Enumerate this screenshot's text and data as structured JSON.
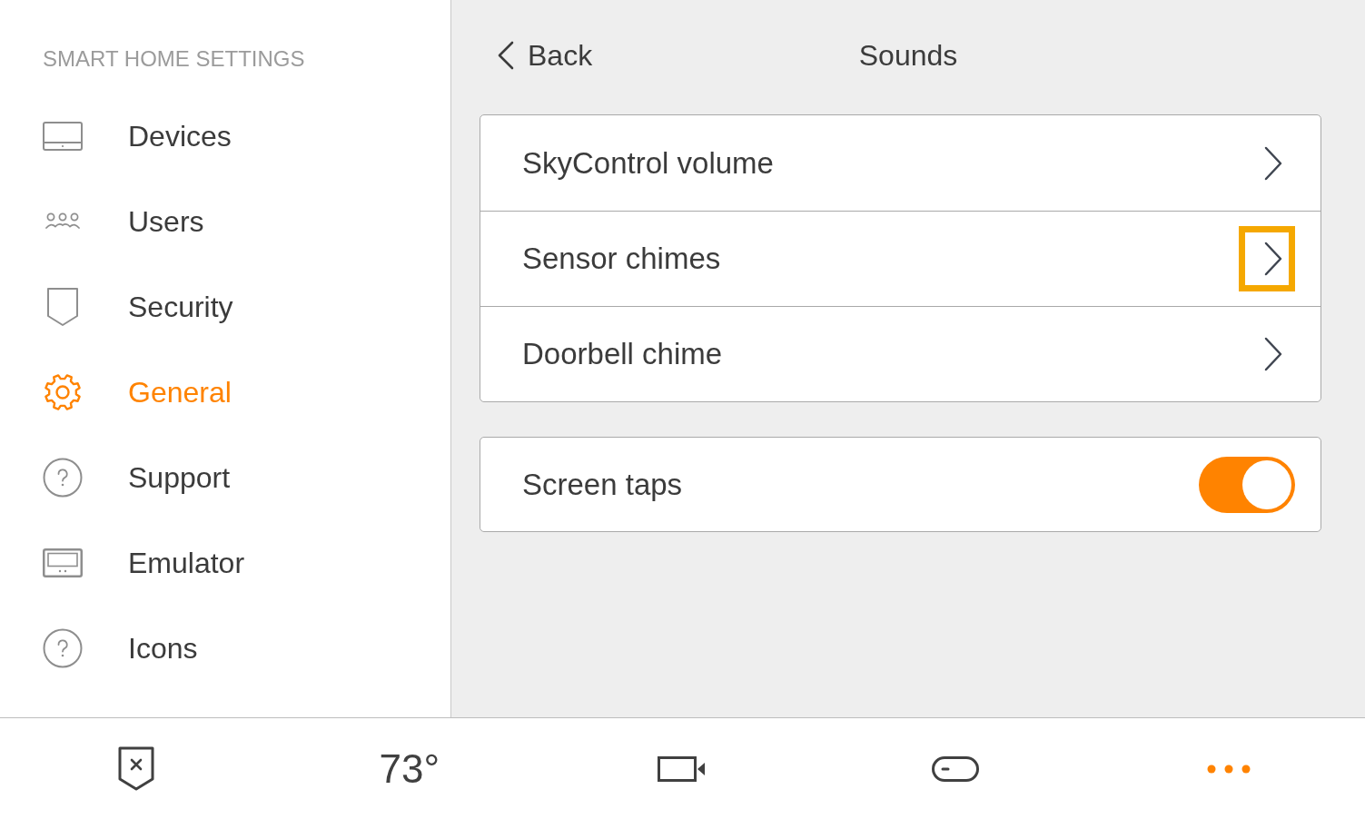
{
  "sidebar": {
    "heading": "SMART HOME SETTINGS",
    "items": [
      {
        "label": "Devices",
        "selected": false
      },
      {
        "label": "Users",
        "selected": false
      },
      {
        "label": "Security",
        "selected": false
      },
      {
        "label": "General",
        "selected": true
      },
      {
        "label": "Support",
        "selected": false
      },
      {
        "label": "Emulator",
        "selected": false
      },
      {
        "label": "Icons",
        "selected": false
      }
    ]
  },
  "header": {
    "back": "Back",
    "title": "Sounds"
  },
  "groups": [
    {
      "rows": [
        {
          "kind": "link",
          "label": "SkyControl volume",
          "highlighted": false
        },
        {
          "kind": "link",
          "label": "Sensor chimes",
          "highlighted": true
        },
        {
          "kind": "link",
          "label": "Doorbell chime",
          "highlighted": false
        }
      ]
    },
    {
      "rows": [
        {
          "kind": "toggle",
          "label": "Screen taps",
          "on": true
        }
      ]
    }
  ],
  "tab_bar": {
    "items": [
      {
        "kind": "icon",
        "selected": false
      },
      {
        "kind": "text",
        "text": "73°",
        "selected": false
      },
      {
        "kind": "icon",
        "selected": false
      },
      {
        "kind": "icon",
        "selected": false
      },
      {
        "kind": "icon",
        "selected": true
      }
    ]
  }
}
